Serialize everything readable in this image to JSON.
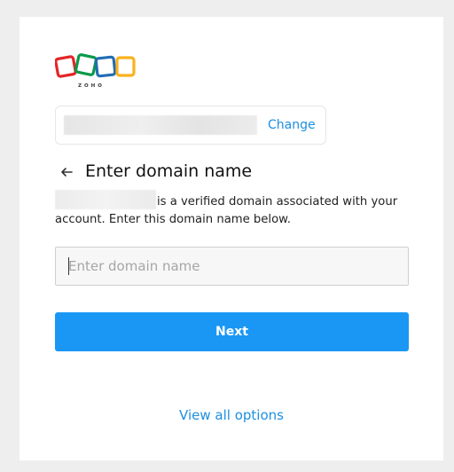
{
  "brand": {
    "logo_text": "ZOHO"
  },
  "account": {
    "change_label": "Change"
  },
  "step": {
    "title": "Enter domain name"
  },
  "description": "is a verified domain associated with your account. Enter this domain name below.",
  "domain_input": {
    "value": "",
    "placeholder": "Enter domain name"
  },
  "next_label": "Next",
  "view_all_label": "View all options",
  "colors": {
    "accent": "#1a97f5",
    "link": "#1d8fe1",
    "logo_red": "#e42527",
    "logo_green": "#089949",
    "logo_blue": "#226db4",
    "logo_yellow": "#f9b21d"
  }
}
